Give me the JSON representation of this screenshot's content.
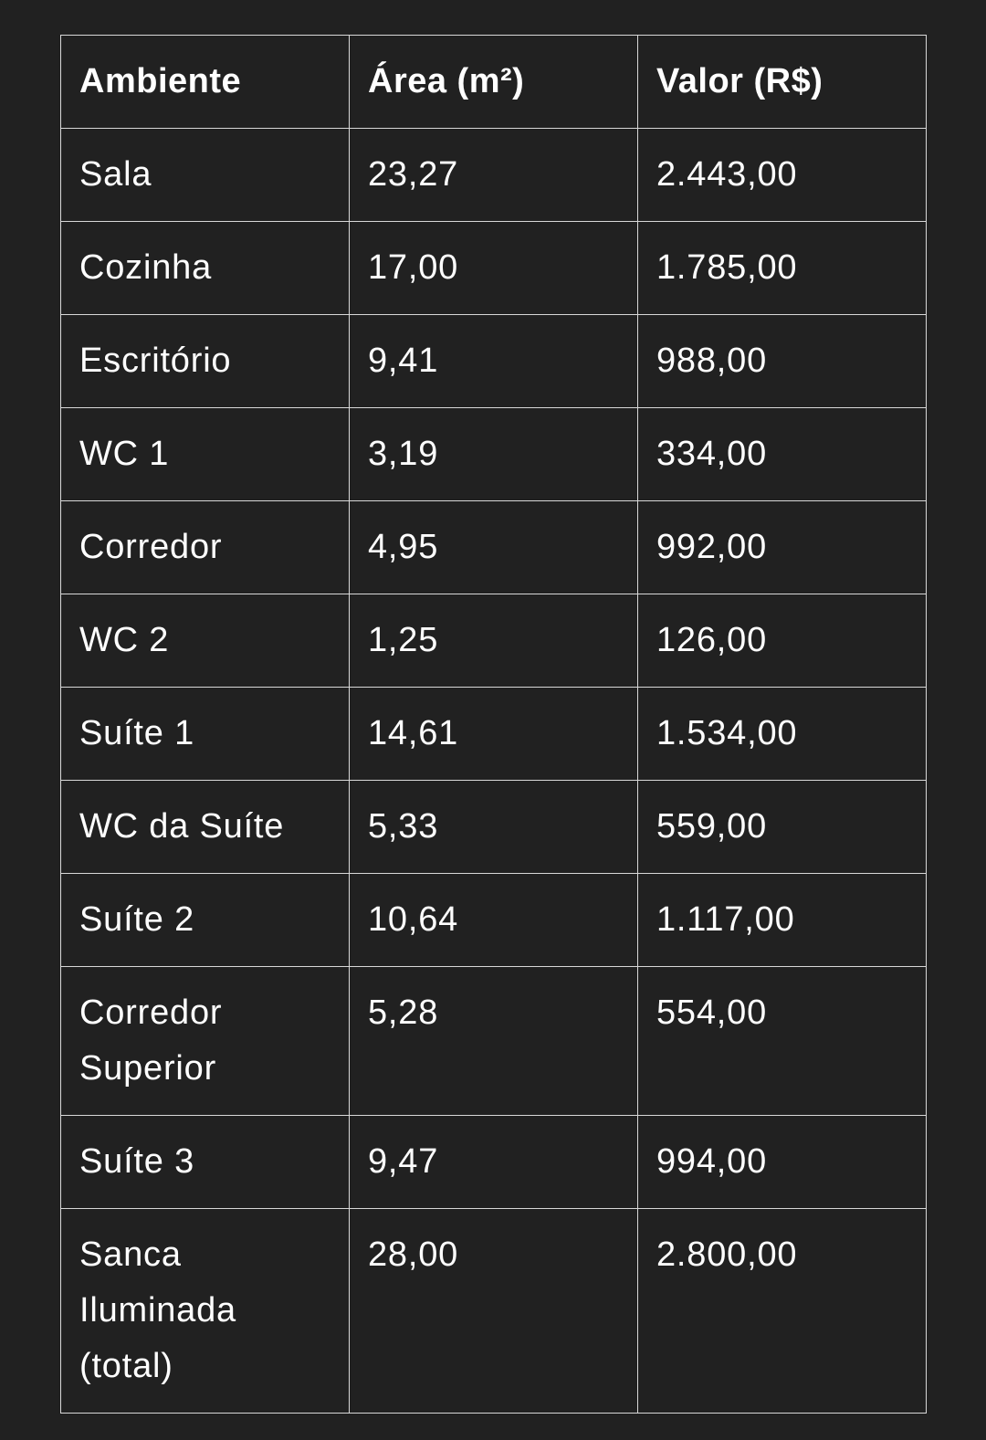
{
  "table": {
    "headers": [
      "Ambiente",
      "Área (m²)",
      "Valor (R$)"
    ],
    "rows": [
      {
        "ambiente": "Sala",
        "area": "23,27",
        "valor": "2.443,00"
      },
      {
        "ambiente": "Cozinha",
        "area": "17,00",
        "valor": "1.785,00"
      },
      {
        "ambiente": "Escritório",
        "area": "9,41",
        "valor": "988,00"
      },
      {
        "ambiente": "WC 1",
        "area": "3,19",
        "valor": "334,00"
      },
      {
        "ambiente": "Corredor",
        "area": "4,95",
        "valor": "992,00"
      },
      {
        "ambiente": "WC 2",
        "area": "1,25",
        "valor": "126,00"
      },
      {
        "ambiente": "Suíte 1",
        "area": "14,61",
        "valor": "1.534,00"
      },
      {
        "ambiente": "WC da Suíte",
        "area": "5,33",
        "valor": "559,00"
      },
      {
        "ambiente": "Suíte 2",
        "area": "10,64",
        "valor": "1.117,00"
      },
      {
        "ambiente": "Corredor Superior",
        "area": "5,28",
        "valor": "554,00"
      },
      {
        "ambiente": "Suíte 3",
        "area": "9,47",
        "valor": "994,00"
      },
      {
        "ambiente": "Sanca Iluminada (total)",
        "area": "28,00",
        "valor": "2.800,00"
      }
    ]
  }
}
